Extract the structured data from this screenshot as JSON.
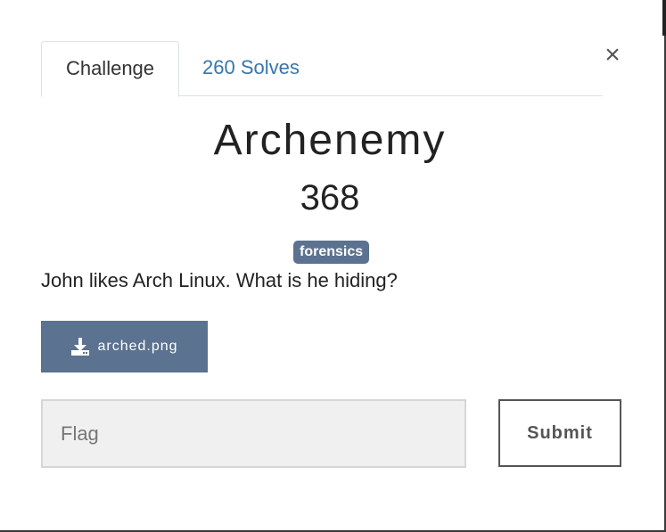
{
  "modal": {
    "close_symbol": "×",
    "tabs": [
      {
        "label": "Challenge"
      },
      {
        "label": "260 Solves"
      }
    ],
    "challenge": {
      "name": "Archenemy",
      "points": "368",
      "tag": "forensics",
      "description": "John likes Arch Linux. What is he hiding?",
      "file": {
        "label": "arched.png",
        "icon": "download-icon"
      }
    },
    "flag_input": {
      "placeholder": "Flag",
      "value": ""
    },
    "submit_label": "Submit"
  },
  "colors": {
    "tag_bg": "#5b7290",
    "link": "#3776ad",
    "input_bg": "#f0f0f0",
    "text": "#222222"
  }
}
